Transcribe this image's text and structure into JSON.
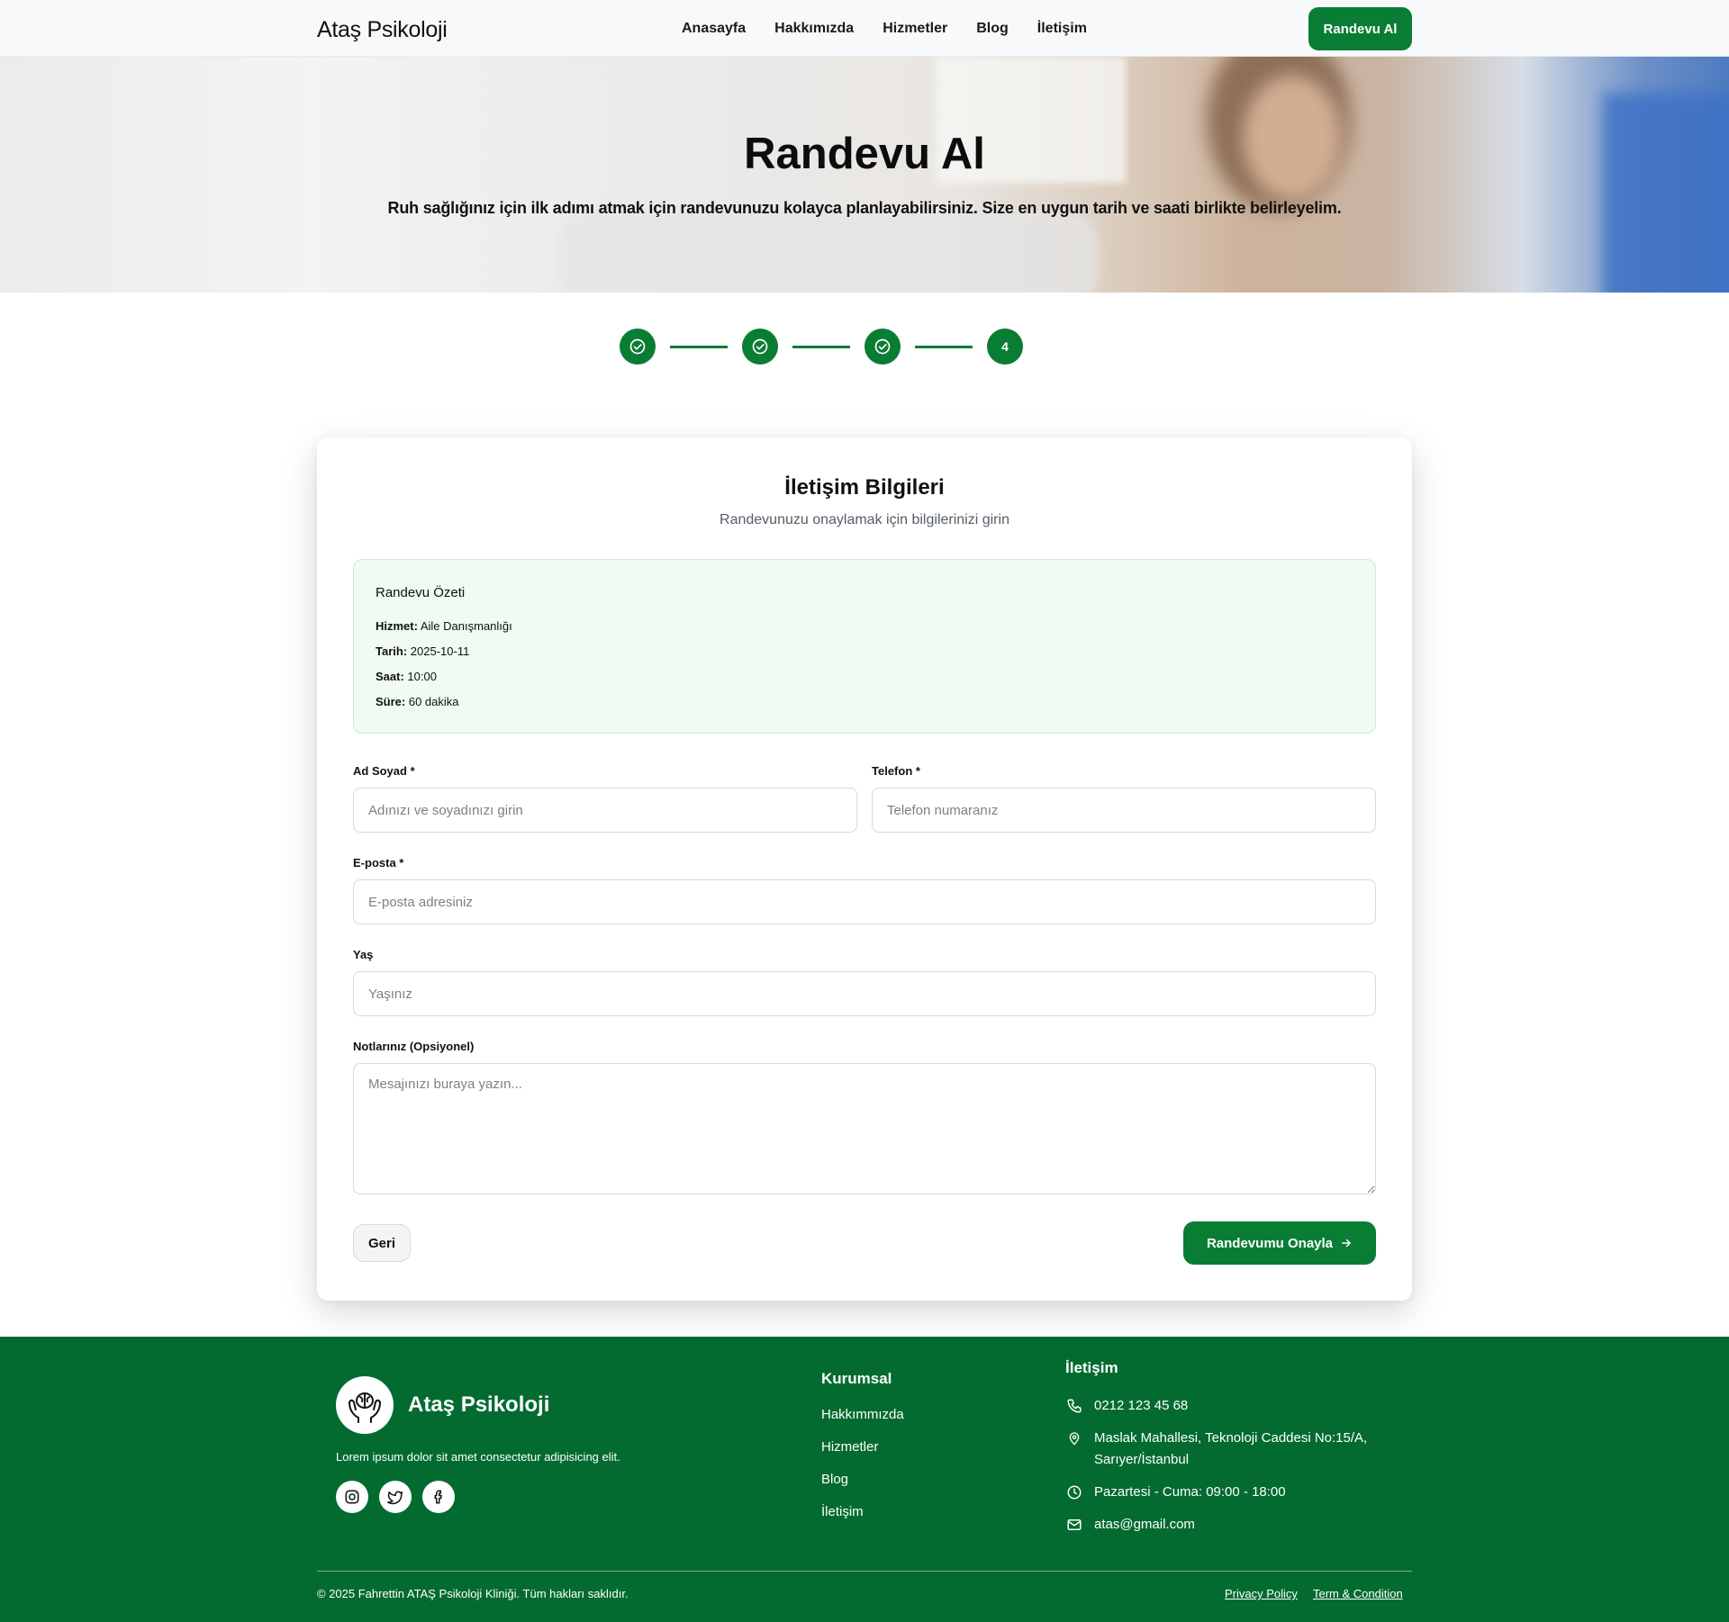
{
  "header": {
    "brand": "Ataş Psikoloji",
    "nav": [
      "Anasayfa",
      "Hakkımızda",
      "Hizmetler",
      "Blog",
      "İletişim"
    ],
    "cta": "Randevu Al"
  },
  "hero": {
    "title": "Randevu Al",
    "subtitle": "Ruh sağlığınız için ilk adımı atmak için randevunuzu kolayca planlayabilirsiniz. Size en uygun tarih ve saati birlikte belirleyelim."
  },
  "stepper": {
    "current_step": "4",
    "completed_steps": 3,
    "total_steps": 4
  },
  "form": {
    "title": "İletişim Bilgileri",
    "subtitle": "Randevunuzu onaylamak için bilgilerinizi girin",
    "summary": {
      "title": "Randevu Özeti",
      "service_label": "Hizmet:",
      "service_value": "Aile Danışmanlığı",
      "date_label": "Tarih:",
      "date_value": "2025-10-11",
      "time_label": "Saat:",
      "time_value": "10:00",
      "duration_label": "Süre:",
      "duration_value": "60 dakika"
    },
    "fields": {
      "name_label": "Ad Soyad *",
      "name_placeholder": "Adınızı ve soyadınızı girin",
      "phone_label": "Telefon *",
      "phone_placeholder": "Telefon numaranız",
      "email_label": "E-posta *",
      "email_placeholder": "E-posta adresiniz",
      "age_label": "Yaş",
      "age_placeholder": "Yaşınız",
      "notes_label": "Notlarınız (Opsiyonel)",
      "notes_placeholder": "Mesajınızı buraya yazın..."
    },
    "back_button": "Geri",
    "confirm_button": "Randevumu Onayla"
  },
  "footer": {
    "brand": "Ataş Psikoloji",
    "description": "Lorem ipsum dolor sit amet consectetur adipisicing elit.",
    "corporate_title": "Kurumsal",
    "corporate_links": [
      "Hakkımmızda",
      "Hizmetler",
      "Blog",
      "İletişim"
    ],
    "contact_title": "İletişim",
    "phone": "0212 123 45 68",
    "address_line1": "Maslak Mahallesi, Teknoloji Caddesi No:15/A,",
    "address_line2": "Sarıyer/İstanbul",
    "hours": "Pazartesi - Cuma: 09:00 - 18:00",
    "email": "atas@gmail.com",
    "copyright": "© 2025 Fahrettin ATAŞ Psikoloji Kliniği. Tüm hakları saklıdır.",
    "privacy": "Privacy Policy",
    "terms": "Term & Condition"
  },
  "colors": {
    "brand_green": "#0a7d35",
    "footer_green": "#046b30",
    "summary_bg": "#f0fbf3"
  },
  "icons": [
    "check-circle-icon",
    "arrow-right-icon",
    "brain-hands-icon",
    "instagram-icon",
    "twitter-icon",
    "facebook-icon",
    "phone-icon",
    "location-pin-icon",
    "clock-icon",
    "mail-icon"
  ]
}
